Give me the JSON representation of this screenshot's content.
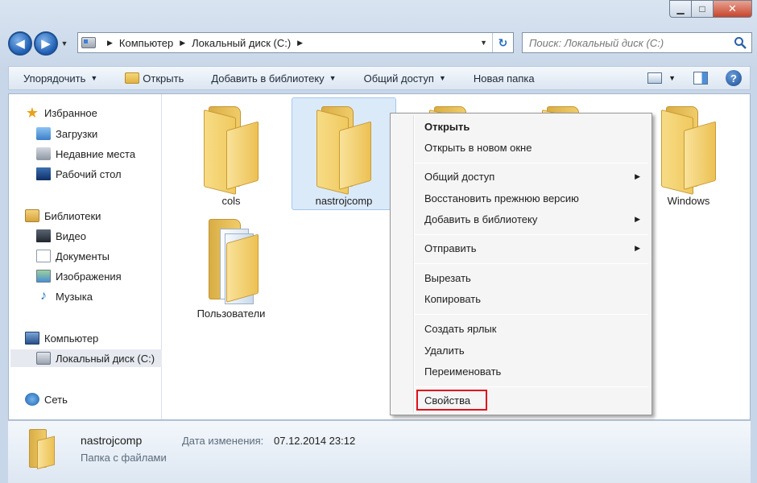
{
  "window": {
    "minimize_glyph": "▁",
    "maximize_glyph": "□",
    "close_glyph": "✕"
  },
  "nav": {
    "back_glyph": "◀",
    "forward_glyph": "▶",
    "dropdown_glyph": "▼",
    "address": {
      "icon": "drive-icon",
      "breadcrumb": [
        "Компьютер",
        "Локальный диск (C:)"
      ],
      "separator_glyph": "▶",
      "refresh_glyph": "↻"
    },
    "search": {
      "placeholder": "Поиск: Локальный диск (C:)",
      "icon": "search-icon"
    }
  },
  "toolbar": {
    "organize": "Упорядочить",
    "open": "Открыть",
    "add_to_library": "Добавить в библиотеку",
    "share": "Общий доступ",
    "new_folder": "Новая папка",
    "dropdown_glyph": "▼",
    "help_glyph": "?"
  },
  "sidebar": {
    "favorites": {
      "label": "Избранное",
      "items": [
        "Загрузки",
        "Недавние места",
        "Рабочий стол"
      ]
    },
    "libraries": {
      "label": "Библиотеки",
      "items": [
        "Видео",
        "Документы",
        "Изображения",
        "Музыка"
      ]
    },
    "computer": {
      "label": "Компьютер",
      "items": [
        "Локальный диск (C:)"
      ]
    },
    "network": {
      "label": "Сеть"
    }
  },
  "folders": [
    {
      "name": "cols",
      "selected": false
    },
    {
      "name": "nastrojcomp",
      "selected": true
    },
    {
      "name": "Windows",
      "selected": false
    },
    {
      "name": "Пользователи",
      "selected": false
    }
  ],
  "context_menu": {
    "items": [
      {
        "label": "Открыть",
        "bold": true
      },
      {
        "label": "Открыть в новом окне"
      },
      {
        "label": "Общий доступ",
        "submenu": true
      },
      {
        "label": "Восстановить прежнюю версию"
      },
      {
        "label": "Добавить в библиотеку",
        "submenu": true
      },
      {
        "label": "Отправить",
        "submenu": true
      },
      {
        "label": "Вырезать"
      },
      {
        "label": "Копировать"
      },
      {
        "label": "Создать ярлык"
      },
      {
        "label": "Удалить"
      },
      {
        "label": "Переименовать"
      },
      {
        "label": "Свойства",
        "highlighted": true
      }
    ],
    "submenu_glyph": "▶",
    "highlight_color": "#e0101a"
  },
  "details": {
    "name": "nastrojcomp",
    "type": "Папка с файлами",
    "date_label": "Дата изменения:",
    "date_value": "07.12.2014 23:12"
  },
  "colors": {
    "selection": "#dbeaf9",
    "accent": "#1f5fb3"
  }
}
